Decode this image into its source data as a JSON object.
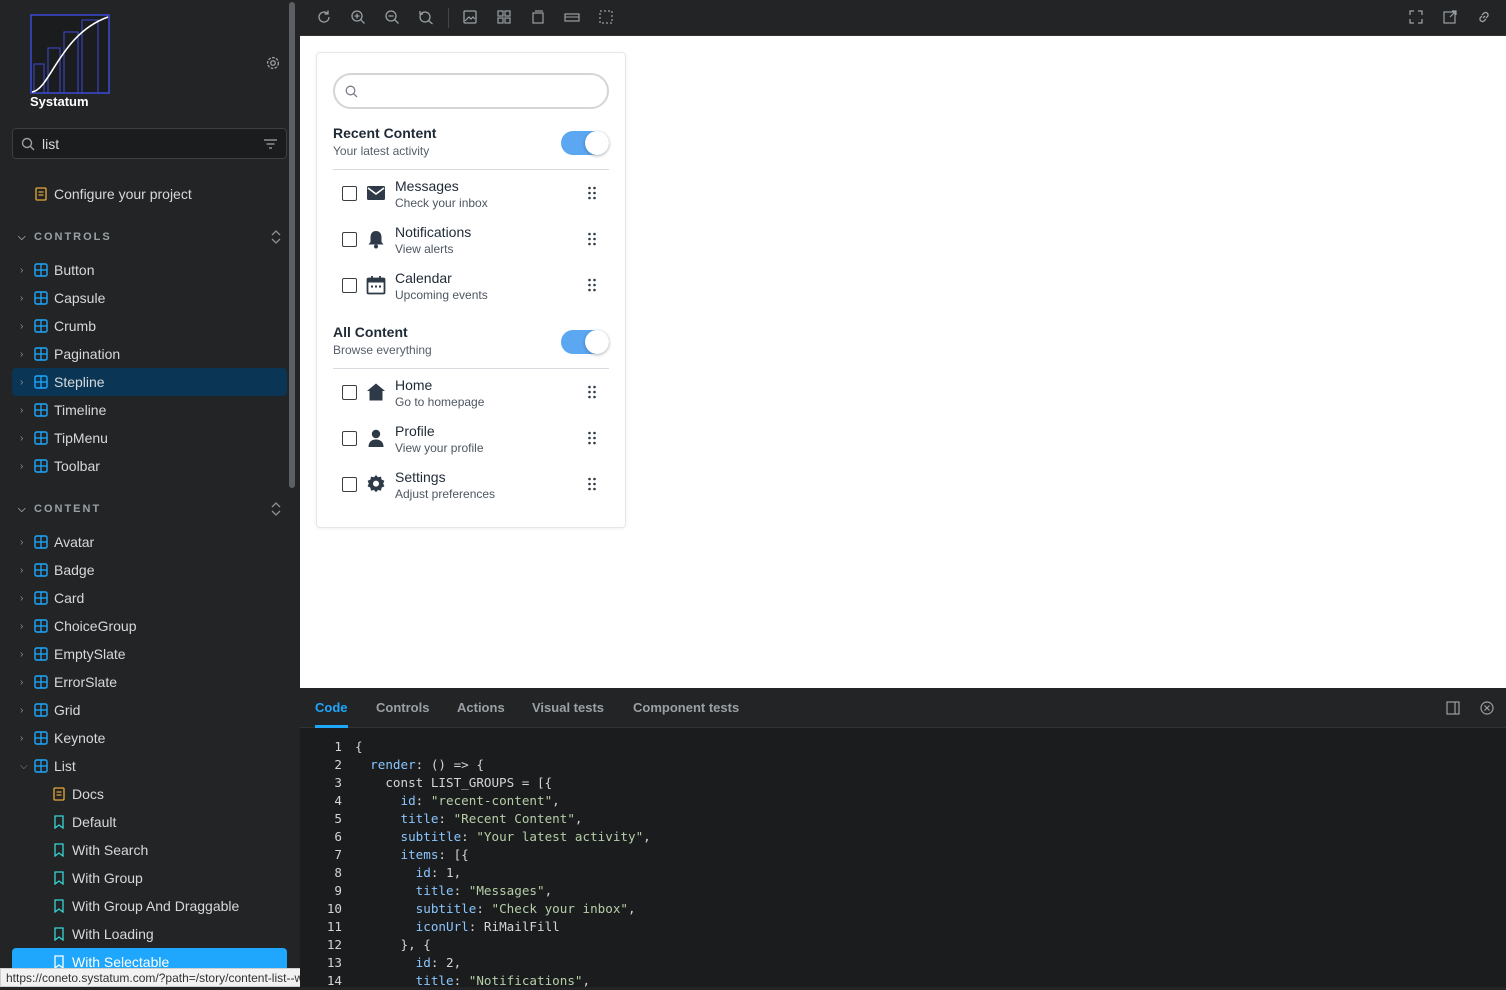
{
  "sidebar": {
    "brand": "Systatum",
    "search_value": "list",
    "configure_label": "Configure your project",
    "sections": [
      {
        "label": "CONTROLS",
        "items": [
          "Button",
          "Capsule",
          "Crumb",
          "Pagination",
          "Stepline",
          "Timeline",
          "TipMenu",
          "Toolbar"
        ]
      },
      {
        "label": "CONTENT",
        "items": [
          "Avatar",
          "Badge",
          "Card",
          "ChoiceGroup",
          "EmptySlate",
          "ErrorSlate",
          "Grid",
          "Keynote",
          "List"
        ]
      }
    ],
    "list_children": [
      "Docs",
      "Default",
      "With Search",
      "With Group",
      "With Group And Draggable",
      "With Loading",
      "With Selectable"
    ],
    "status_url": "https://coneto.systatum.com/?path=/story/content-list--with-selectable"
  },
  "preview": {
    "groups": [
      {
        "title": "Recent Content",
        "subtitle": "Your latest activity",
        "items": [
          {
            "title": "Messages",
            "subtitle": "Check your inbox",
            "icon": "mail-icon"
          },
          {
            "title": "Notifications",
            "subtitle": "View alerts",
            "icon": "bell-icon"
          },
          {
            "title": "Calendar",
            "subtitle": "Upcoming events",
            "icon": "calendar-icon"
          }
        ]
      },
      {
        "title": "All Content",
        "subtitle": "Browse everything",
        "items": [
          {
            "title": "Home",
            "subtitle": "Go to homepage",
            "icon": "home-icon"
          },
          {
            "title": "Profile",
            "subtitle": "View your profile",
            "icon": "user-icon"
          },
          {
            "title": "Settings",
            "subtitle": "Adjust preferences",
            "icon": "gear-icon"
          }
        ]
      }
    ]
  },
  "panel": {
    "tabs": [
      "Code",
      "Controls",
      "Actions",
      "Visual tests",
      "Component tests"
    ],
    "active_tab": "Code",
    "code_lines": [
      "{",
      "  render: () => {",
      "    const LIST_GROUPS = [{",
      "      id: \"recent-content\",",
      "      title: \"Recent Content\",",
      "      subtitle: \"Your latest activity\",",
      "      items: [{",
      "        id: 1,",
      "        title: \"Messages\",",
      "        subtitle: \"Check your inbox\",",
      "        iconUrl: RiMailFill",
      "      }, {",
      "        id: 2,",
      "        title: \"Notifications\","
    ]
  },
  "colors": {
    "accent": "#1ea7fd",
    "toggle": "#5ba7f2",
    "sidebar_bg": "#222425"
  }
}
